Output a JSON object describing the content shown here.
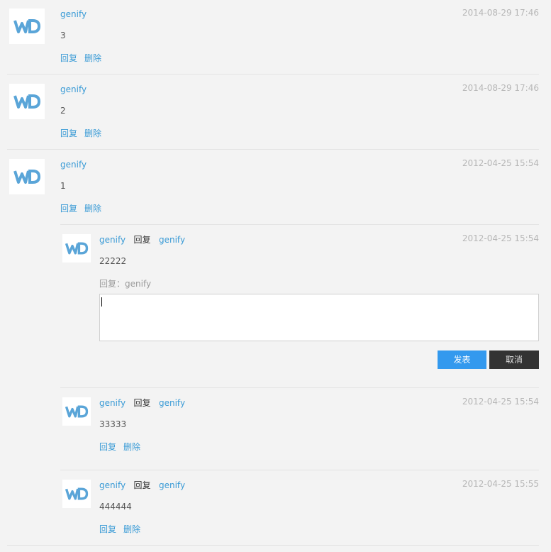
{
  "colors": {
    "accent": "#3a9bd6",
    "post_button": "#3399ee",
    "cancel_button": "#333333",
    "background": "#f3f3f3"
  },
  "comments": [
    {
      "author": "genify",
      "time": "2014-08-29 17:46",
      "content": "3",
      "reply": "回复",
      "delete": "删除"
    },
    {
      "author": "genify",
      "time": "2014-08-29 17:46",
      "content": "2",
      "reply": "回复",
      "delete": "删除"
    },
    {
      "author": "genify",
      "time": "2012-04-25 15:54",
      "content": "1",
      "reply": "回复",
      "delete": "删除"
    }
  ],
  "replies": [
    {
      "author": "genify",
      "reply_word": "回复",
      "target": "genify",
      "time": "2012-04-25 15:54",
      "content": "22222"
    },
    {
      "author": "genify",
      "reply_word": "回复",
      "target": "genify",
      "time": "2012-04-25 15:54",
      "content": "33333",
      "reply": "回复",
      "delete": "删除"
    },
    {
      "author": "genify",
      "reply_word": "回复",
      "target": "genify",
      "time": "2012-04-25 15:55",
      "content": "444444",
      "reply": "回复",
      "delete": "删除"
    }
  ],
  "reply_form": {
    "label": "回复：genify",
    "value": "",
    "post_label": "发表",
    "cancel_label": "取消"
  },
  "avatar_icon": "wd-logo-icon"
}
